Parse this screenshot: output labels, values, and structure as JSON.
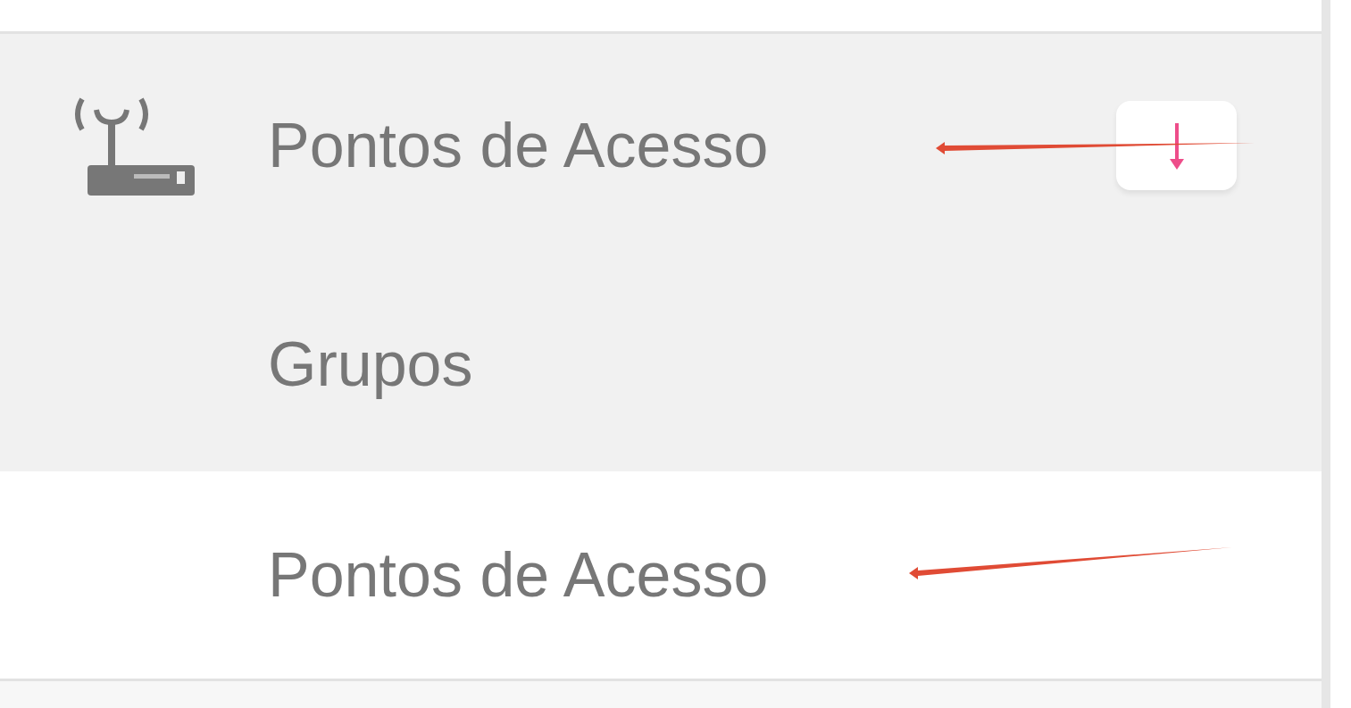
{
  "menu": {
    "items": [
      {
        "label": "Pontos de Acesso",
        "expanded": true,
        "children": [
          {
            "label": "Grupos",
            "selected": false
          },
          {
            "label": "Pontos de Acesso",
            "selected": true
          }
        ]
      }
    ]
  },
  "annotations": [
    {
      "kind": "arrow"
    },
    {
      "kind": "arrow"
    }
  ]
}
